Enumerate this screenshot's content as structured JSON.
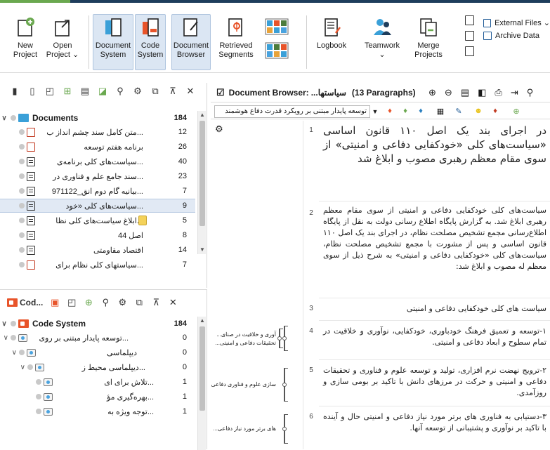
{
  "ribbon": {
    "buttons": [
      {
        "label": "New\nProject"
      },
      {
        "label": "Open\nProject ⌄"
      },
      {
        "label": "Document\nSystem"
      },
      {
        "label": "Code\nSystem"
      },
      {
        "label": "Document\nBrowser"
      },
      {
        "label": "Retrieved\nSegments"
      },
      {
        "label": ""
      },
      {
        "label": "Logbook"
      },
      {
        "label": "Teamwork\n⌄"
      },
      {
        "label": "Merge\nProjects"
      }
    ],
    "external_files": "External Files ⌄",
    "archive_data": "Archive Data"
  },
  "documents_panel": {
    "root_label": "Documents",
    "root_count": "184",
    "items": [
      {
        "label": "...متن کامل سند چشم انداز ب",
        "count": "12",
        "icon": "pdf"
      },
      {
        "label": "برنامه هفتم توسعه",
        "count": "26",
        "icon": "pdf"
      },
      {
        "label": "...سیاست‌های کلی برنامه‌ی",
        "count": "40",
        "icon": "doc"
      },
      {
        "label": "...سند جامع علم و فناوری در",
        "count": "23",
        "icon": "doc"
      },
      {
        "label": "...بیانیه گام دوم انق_971122",
        "count": "7",
        "icon": "doc"
      },
      {
        "label": "...سیاست‌های کلی «خود",
        "count": "9",
        "icon": "doc"
      },
      {
        "label": "...ابلاغ سیاست‌های کلی نظا",
        "count": "5",
        "icon": "doc"
      },
      {
        "label": "اصل 44",
        "count": "8",
        "icon": "doc"
      },
      {
        "label": "اقتصاد مقاومتی",
        "count": "14",
        "icon": "doc"
      },
      {
        "label": "...سیاستهای کلی نظام برای",
        "count": "7",
        "icon": "pdf"
      }
    ]
  },
  "code_panel": {
    "title": "Cod...",
    "root_label": "Code System",
    "root_count": "184",
    "items": [
      {
        "label": "...توسعه پایدار مبتنی بر روی",
        "count": "0"
      },
      {
        "label": "دیپلماسی",
        "count": "0"
      },
      {
        "label": "...دیپلماسی محیط ز",
        "count": "0"
      },
      {
        "label": "...تلاش برای ای",
        "count": "1"
      },
      {
        "label": "...بهره‌گیری مؤ",
        "count": "1"
      },
      {
        "label": "...توجه ویژه به",
        "count": "1"
      }
    ]
  },
  "browser": {
    "title_prefix": "Document Browser:",
    "doc_name": "...سیاستها",
    "paragraphs_info": "(13 Paragraphs)",
    "code_selector": "توسعه پایدار مبتنی بر رویکرد قدرت دفاع هوشمند",
    "paragraphs": [
      {
        "num": "1",
        "text": "در اجرای بند یک اصل ۱۱۰ قانون اساسی «سیاست‌های کلی «خودکفایی دفاعی و امنیتی» از سوی مقام معظم رهبری مصوب و ابلاغ شد"
      },
      {
        "num": "2",
        "text": "سیاست‌های کلی خودکفایی دفاعی و امنیتی از سوی مقام معظم رهبری ابلاغ شد. به گزارش پایگاه اطلاع رسانی دولت به نقل از پایگاه اطلاع‌رسانی مجمع تشخیص مصلحت نظام، در اجرای بند یک اصل ۱۱۰ قانون اساسی و پس از مشورت با مجمع تشخیص مصلحت نظام، سیاست‌های کلی «خودکفایی دفاعی و امنیتی» به شرح ذیل از سوی معظم له مصوب و ابلاغ شد:"
      },
      {
        "num": "3",
        "text": "سیاست های کلی خودکفایی دفاعی و امنیتی"
      },
      {
        "num": "4",
        "text": "۱-توسعه و تعمیق فرهنگ خودباوری، خودکفایی، نوآوری و خلاقیت در تمام سطوح و ابعاد دفاعی و امنیتی."
      },
      {
        "num": "5",
        "text": "۲-ترویج نهضت نرم افزاری، تولید و توسعه علوم و فناوری و تحقیقات دفاعی و امنیتی و حرکت در مرزهای دانش با تاکید بر بومی سازی و روزآمدی."
      },
      {
        "num": "6",
        "text": "۳-دستیابی به فناوری های برتر مورد نیاز دفاعی و امنیتی حال و آینده با تاکید بر نوآوری و پشتیبانی از توسعه آنها."
      }
    ],
    "code_labels": [
      {
        "text": "آوری و خلاقیت در صنای..."
      },
      {
        "text": "تحقیقات دفاعی و امنیتی..."
      },
      {
        "text": "سازی علوم و فناوری دفاعی..."
      },
      {
        "text": "های برتر مورد نیاز دفاعی..."
      }
    ]
  }
}
